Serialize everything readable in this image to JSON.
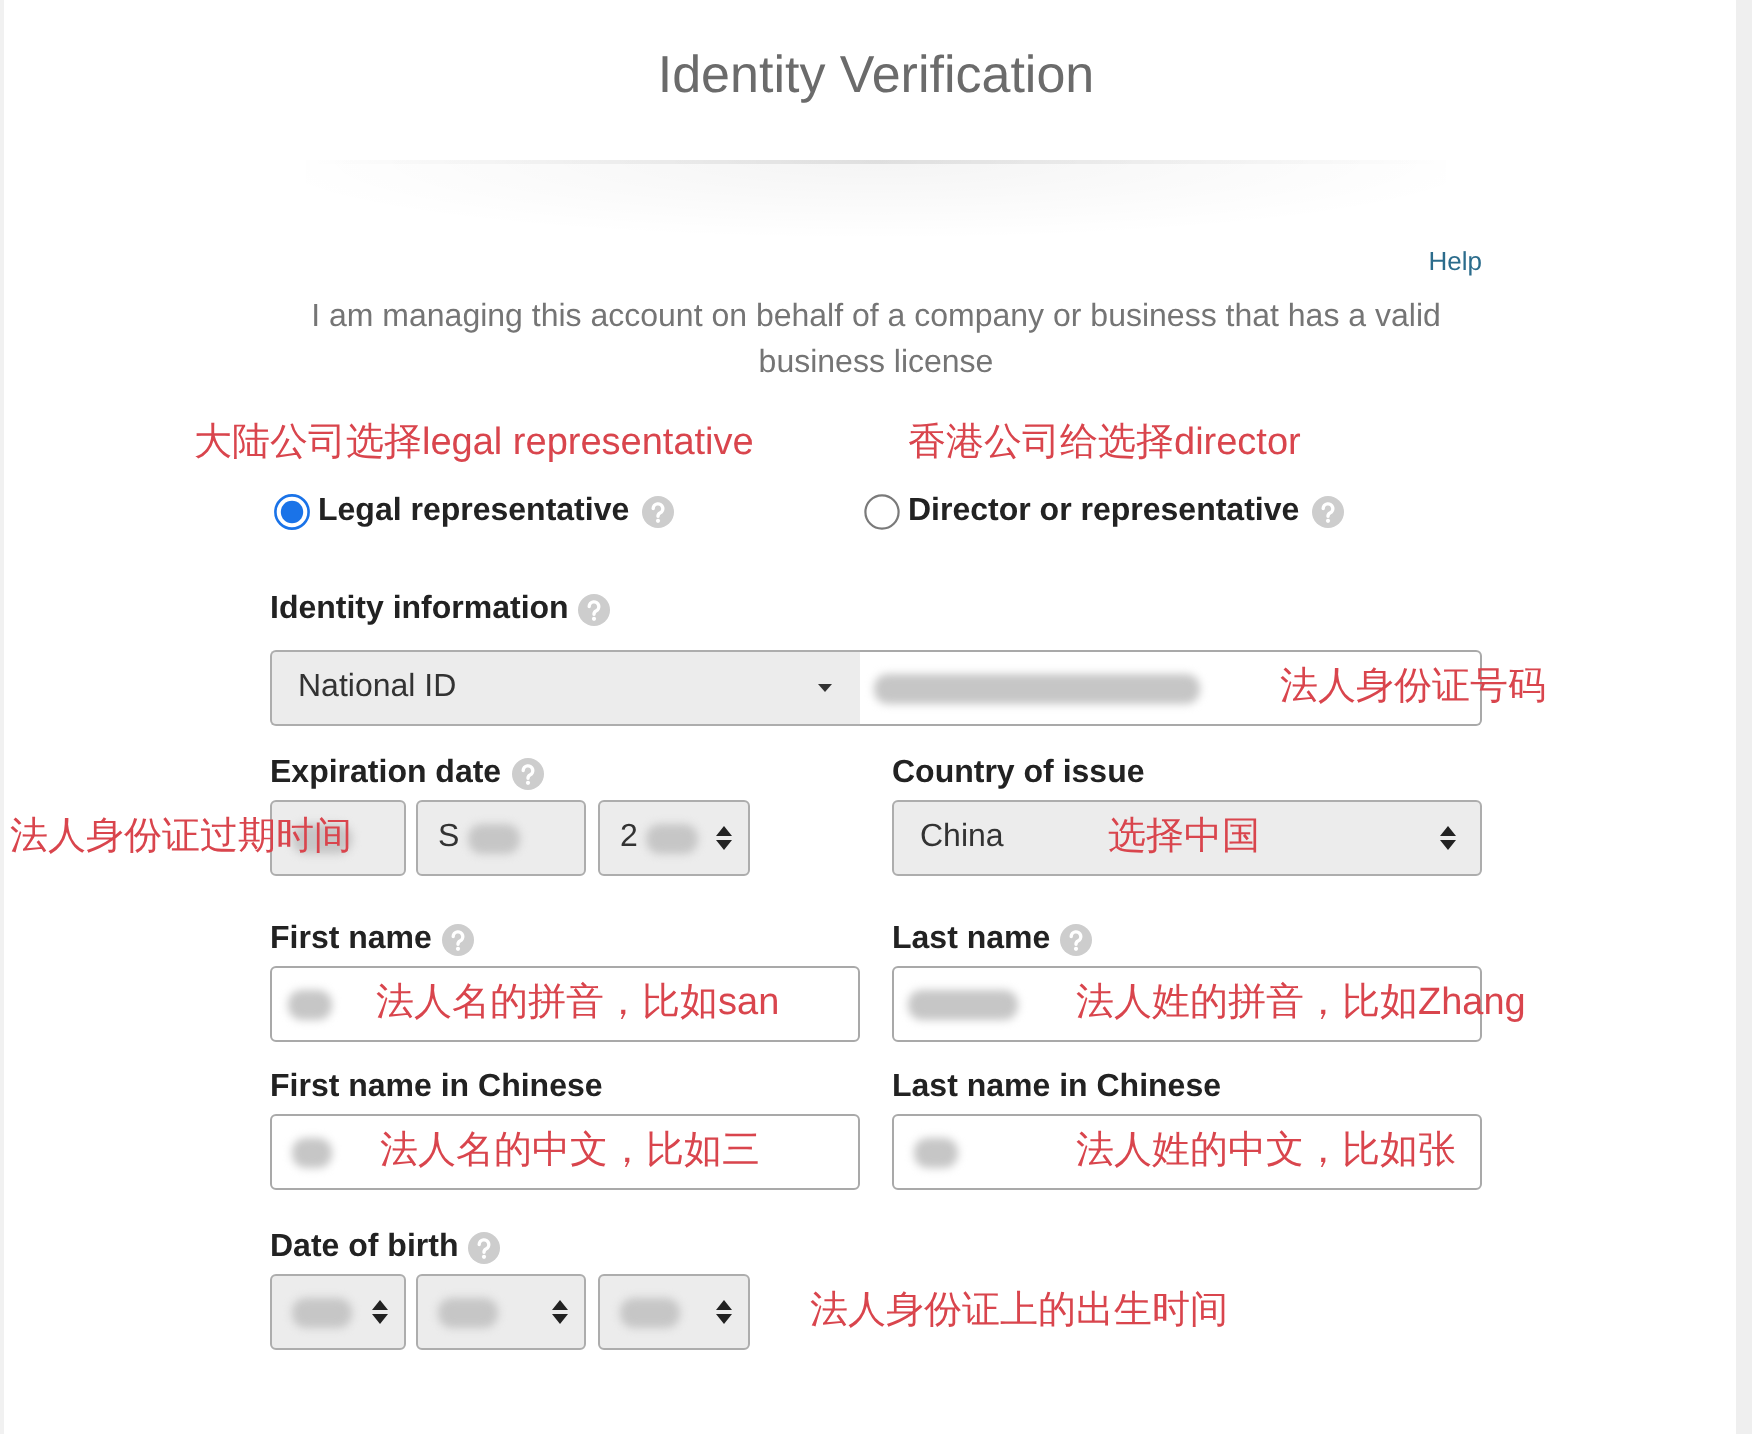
{
  "title": "Identity Verification",
  "help_link": "Help",
  "intro": "I am managing this account on behalf of a company or business that has a valid business license",
  "role_options": [
    {
      "label": "Legal representative",
      "selected": true,
      "help": true,
      "annotation": "大陆公司选择legal representative"
    },
    {
      "label": "Director or representative",
      "selected": false,
      "help": true,
      "annotation": "香港公司给选择director"
    }
  ],
  "rows": [
    {
      "fields": [
        {
          "kind": "id",
          "label": "Identity information",
          "help": true,
          "id_type": "National ID",
          "number_redacted": true,
          "annotation": "法人身份证号码"
        }
      ]
    },
    {
      "fields": [
        {
          "kind": "date",
          "label": "Expiration date",
          "help": true,
          "annotation": "法人身份证过期时间",
          "parts": [
            {
              "redacted": true,
              "arrows": false
            },
            {
              "value": "S",
              "redacted": true,
              "arrows": false
            },
            {
              "value": "2",
              "redacted": true,
              "arrows": true
            }
          ]
        },
        {
          "kind": "select",
          "label": "Country of issue",
          "help": false,
          "value": "China",
          "annotation": "选择中国"
        }
      ]
    },
    {
      "fields": [
        {
          "kind": "text",
          "label": "First name",
          "help": true,
          "redacted": true,
          "annotation": "法人名的拼音，比如san"
        },
        {
          "kind": "text",
          "label": "Last name",
          "help": true,
          "redacted": true,
          "annotation": "法人姓的拼音，比如Zhang"
        }
      ]
    },
    {
      "fields": [
        {
          "kind": "text",
          "label": "First name in Chinese",
          "help": false,
          "redacted": true,
          "annotation": "法人名的中文，比如三"
        },
        {
          "kind": "text",
          "label": "Last name in Chinese",
          "help": false,
          "redacted": true,
          "annotation": "法人姓的中文，比如张"
        }
      ]
    },
    {
      "fields": [
        {
          "kind": "date",
          "label": "Date of birth",
          "help": true,
          "annotation": "法人身份证上的出生时间",
          "parts": [
            {
              "redacted": true,
              "arrows": true
            },
            {
              "redacted": true,
              "arrows": true
            },
            {
              "redacted": true,
              "arrows": true
            }
          ]
        }
      ]
    }
  ]
}
